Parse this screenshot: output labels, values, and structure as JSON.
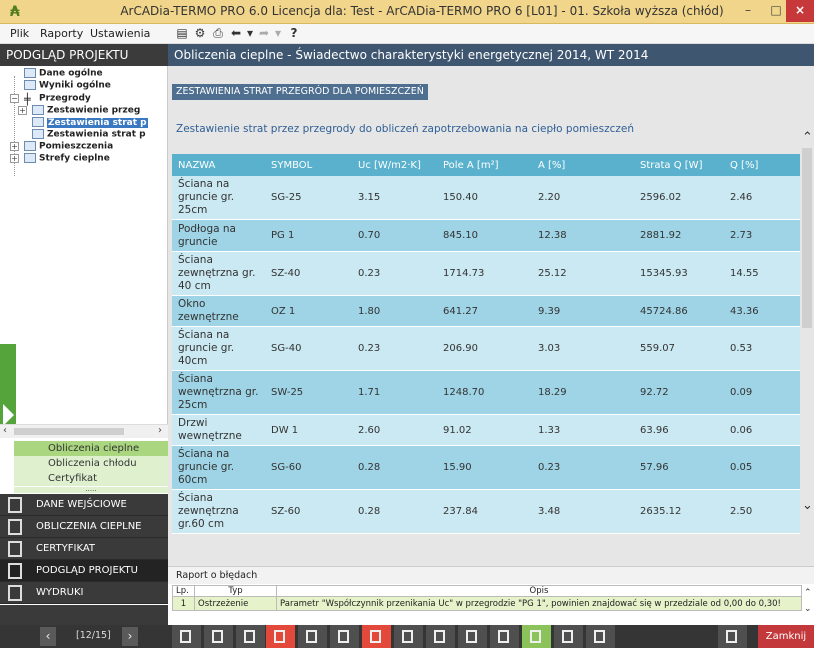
{
  "window": {
    "title": "ArCADia-TERMO PRO 6.0 Licencja dla: Test - ArCADia-TERMO PRO 6 [L01] - 01. Szkoła wyższa (chłód)",
    "minimize": "–",
    "maximize": "□",
    "close": "×"
  },
  "menu": {
    "items": [
      "Plik",
      "Raporty",
      "Ustawienia"
    ],
    "toolbar_icons": [
      "save-icon",
      "settings-icon",
      "preview-icon",
      "undo-icon",
      "dropdown-icon",
      "redo-icon",
      "dropdown-icon",
      "help-icon"
    ],
    "help_label": "?"
  },
  "left": {
    "header": "PODGLĄD PROJEKTU",
    "tree": [
      {
        "label": "Dane ogólne"
      },
      {
        "label": "Wyniki ogólne"
      },
      {
        "label": "Przegrody"
      },
      {
        "label": "Zestawienie przeg"
      },
      {
        "label": "Zestawienia strat p"
      },
      {
        "label": "Zestawienia strat p"
      },
      {
        "label": "Pomieszczenia"
      },
      {
        "label": "Strefy cieplne"
      }
    ],
    "subnav": [
      "Obliczenia cieplne",
      "Obliczenia chłodu",
      "Certyfikat"
    ],
    "mainnav": [
      "DANE WEJŚCIOWE",
      "OBLICZENIA CIEPLNE",
      "CERTYFIKAT",
      "PODGLĄD PROJEKTU",
      "WYDRUKI"
    ]
  },
  "content": {
    "header": "Obliczenia cieplne - Świadectwo charakterystyki energetycznej 2014, WT 2014",
    "section_tag": "ZESTAWIENIA STRAT PRZEGRÓD DLA POMIESZCZEŃ",
    "subtitle": "Zestawienie strat przez przegrody do obliczeń zapotrzebowania na ciepło pomieszczeń",
    "columns": [
      "NAZWA",
      "SYMBOL",
      "Uc [W/m2·K]",
      "Pole A [m²]",
      "A [%]",
      "Strata Q [W]",
      "Q [%]"
    ],
    "rows": [
      [
        "Ściana na gruncie gr. 25cm",
        "SG-25",
        "3.15",
        "150.40",
        "2.20",
        "2596.02",
        "2.46"
      ],
      [
        "Podłoga na gruncie",
        "PG 1",
        "0.70",
        "845.10",
        "12.38",
        "2881.92",
        "2.73"
      ],
      [
        "Ściana zewnętrzna gr. 40 cm",
        "SZ-40",
        "0.23",
        "1714.73",
        "25.12",
        "15345.93",
        "14.55"
      ],
      [
        "Okno zewnętrzne",
        "OZ 1",
        "1.80",
        "641.27",
        "9.39",
        "45724.86",
        "43.36"
      ],
      [
        "Ściana na gruncie gr. 40cm",
        "SG-40",
        "0.23",
        "206.90",
        "3.03",
        "559.07",
        "0.53"
      ],
      [
        "Ściana wewnętrzna gr. 25cm",
        "SW-25",
        "1.71",
        "1248.70",
        "18.29",
        "92.72",
        "0.09"
      ],
      [
        "Drzwi wewnętrzne",
        "DW 1",
        "2.60",
        "91.02",
        "1.33",
        "63.96",
        "0.06"
      ],
      [
        "Ściana na gruncie gr. 60cm",
        "SG-60",
        "0.28",
        "15.90",
        "0.23",
        "57.96",
        "0.05"
      ],
      [
        "Ściana zewnętrzna gr.60 cm",
        "SZ-60",
        "0.28",
        "237.84",
        "3.48",
        "2635.12",
        "2.50"
      ]
    ]
  },
  "errors": {
    "title": "Raport o błędach",
    "columns": [
      "Lp.",
      "Typ",
      "Opis"
    ],
    "rows": [
      [
        "1",
        "Ostrzeżenie",
        "Parametr \"Współczynnik przenikania Uc\" w przegrodzie \"PG 1\", powinien znajdować się w przedziale od 0,00 do 0,30!"
      ]
    ]
  },
  "bottom": {
    "prev": "‹",
    "page": "[12/15]",
    "next": "›",
    "close_label": "Zamknij"
  },
  "colors": {
    "table_header": "#5ab1cd",
    "row_light": "#cbe9f2",
    "row_dark": "#9ed4e6",
    "accent_green": "#54a33b",
    "close_red": "#c3383b"
  }
}
